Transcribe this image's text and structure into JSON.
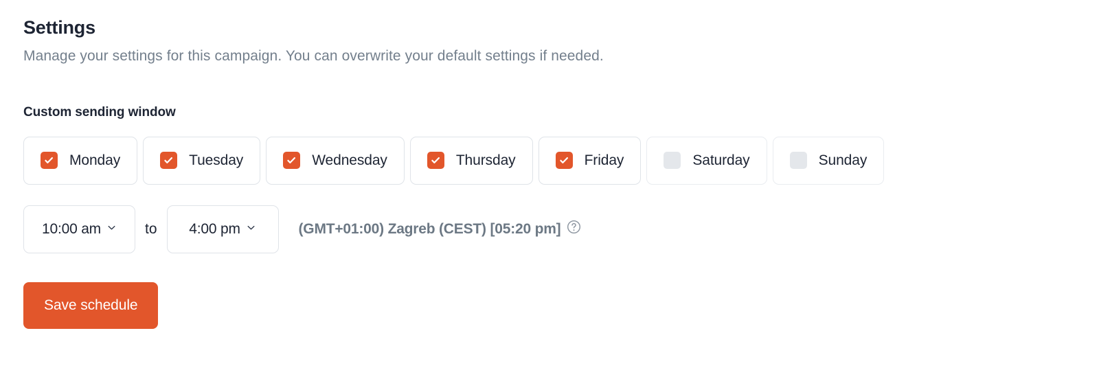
{
  "header": {
    "title": "Settings",
    "subtitle": "Manage your settings for this campaign. You can overwrite your default settings if needed."
  },
  "sending_window": {
    "section_label": "Custom sending window",
    "days": [
      {
        "label": "Monday",
        "checked": true
      },
      {
        "label": "Tuesday",
        "checked": true
      },
      {
        "label": "Wednesday",
        "checked": true
      },
      {
        "label": "Thursday",
        "checked": true
      },
      {
        "label": "Friday",
        "checked": true
      },
      {
        "label": "Saturday",
        "checked": false
      },
      {
        "label": "Sunday",
        "checked": false
      }
    ],
    "start_time": "10:00 am",
    "separator": "to",
    "end_time": "4:00 pm",
    "timezone": "(GMT+01:00) Zagreb (CEST) [05:20 pm]",
    "help_icon": "question-circle-icon",
    "chevron_icon": "chevron-down-icon",
    "check_icon": "check-icon",
    "save_label": "Save schedule"
  },
  "colors": {
    "accent": "#e2562b",
    "checkbox_off": "#e4e7eb",
    "text_primary": "#1d2433",
    "text_muted": "#737f8c",
    "timezone_text": "#6c7884",
    "border": "#dfe3e8",
    "border_light": "#e9ecf0"
  }
}
